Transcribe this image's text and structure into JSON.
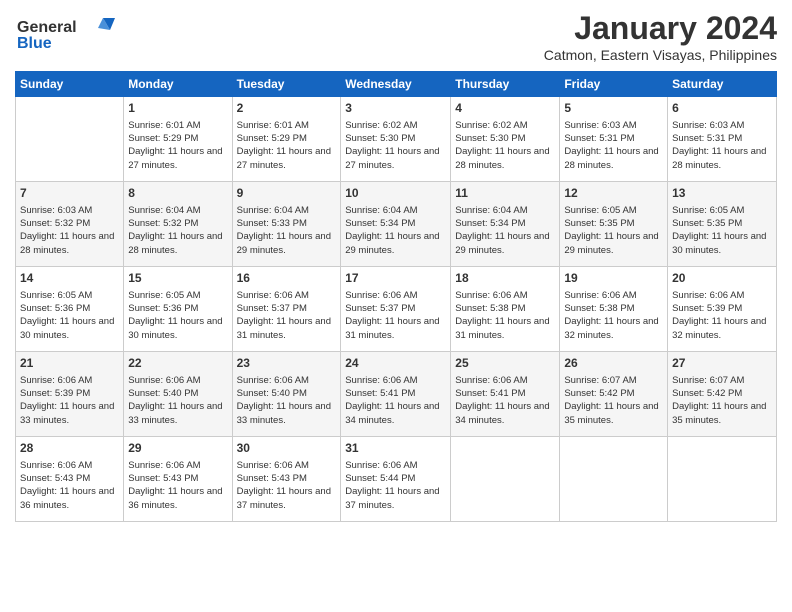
{
  "logo": {
    "line1": "General",
    "line2": "Blue"
  },
  "title": "January 2024",
  "subtitle": "Catmon, Eastern Visayas, Philippines",
  "days_of_week": [
    "Sunday",
    "Monday",
    "Tuesday",
    "Wednesday",
    "Thursday",
    "Friday",
    "Saturday"
  ],
  "weeks": [
    [
      {
        "day": "",
        "sunrise": "",
        "sunset": "",
        "daylight": ""
      },
      {
        "day": "1",
        "sunrise": "Sunrise: 6:01 AM",
        "sunset": "Sunset: 5:29 PM",
        "daylight": "Daylight: 11 hours and 27 minutes."
      },
      {
        "day": "2",
        "sunrise": "Sunrise: 6:01 AM",
        "sunset": "Sunset: 5:29 PM",
        "daylight": "Daylight: 11 hours and 27 minutes."
      },
      {
        "day": "3",
        "sunrise": "Sunrise: 6:02 AM",
        "sunset": "Sunset: 5:30 PM",
        "daylight": "Daylight: 11 hours and 27 minutes."
      },
      {
        "day": "4",
        "sunrise": "Sunrise: 6:02 AM",
        "sunset": "Sunset: 5:30 PM",
        "daylight": "Daylight: 11 hours and 28 minutes."
      },
      {
        "day": "5",
        "sunrise": "Sunrise: 6:03 AM",
        "sunset": "Sunset: 5:31 PM",
        "daylight": "Daylight: 11 hours and 28 minutes."
      },
      {
        "day": "6",
        "sunrise": "Sunrise: 6:03 AM",
        "sunset": "Sunset: 5:31 PM",
        "daylight": "Daylight: 11 hours and 28 minutes."
      }
    ],
    [
      {
        "day": "7",
        "sunrise": "Sunrise: 6:03 AM",
        "sunset": "Sunset: 5:32 PM",
        "daylight": "Daylight: 11 hours and 28 minutes."
      },
      {
        "day": "8",
        "sunrise": "Sunrise: 6:04 AM",
        "sunset": "Sunset: 5:32 PM",
        "daylight": "Daylight: 11 hours and 28 minutes."
      },
      {
        "day": "9",
        "sunrise": "Sunrise: 6:04 AM",
        "sunset": "Sunset: 5:33 PM",
        "daylight": "Daylight: 11 hours and 29 minutes."
      },
      {
        "day": "10",
        "sunrise": "Sunrise: 6:04 AM",
        "sunset": "Sunset: 5:34 PM",
        "daylight": "Daylight: 11 hours and 29 minutes."
      },
      {
        "day": "11",
        "sunrise": "Sunrise: 6:04 AM",
        "sunset": "Sunset: 5:34 PM",
        "daylight": "Daylight: 11 hours and 29 minutes."
      },
      {
        "day": "12",
        "sunrise": "Sunrise: 6:05 AM",
        "sunset": "Sunset: 5:35 PM",
        "daylight": "Daylight: 11 hours and 29 minutes."
      },
      {
        "day": "13",
        "sunrise": "Sunrise: 6:05 AM",
        "sunset": "Sunset: 5:35 PM",
        "daylight": "Daylight: 11 hours and 30 minutes."
      }
    ],
    [
      {
        "day": "14",
        "sunrise": "Sunrise: 6:05 AM",
        "sunset": "Sunset: 5:36 PM",
        "daylight": "Daylight: 11 hours and 30 minutes."
      },
      {
        "day": "15",
        "sunrise": "Sunrise: 6:05 AM",
        "sunset": "Sunset: 5:36 PM",
        "daylight": "Daylight: 11 hours and 30 minutes."
      },
      {
        "day": "16",
        "sunrise": "Sunrise: 6:06 AM",
        "sunset": "Sunset: 5:37 PM",
        "daylight": "Daylight: 11 hours and 31 minutes."
      },
      {
        "day": "17",
        "sunrise": "Sunrise: 6:06 AM",
        "sunset": "Sunset: 5:37 PM",
        "daylight": "Daylight: 11 hours and 31 minutes."
      },
      {
        "day": "18",
        "sunrise": "Sunrise: 6:06 AM",
        "sunset": "Sunset: 5:38 PM",
        "daylight": "Daylight: 11 hours and 31 minutes."
      },
      {
        "day": "19",
        "sunrise": "Sunrise: 6:06 AM",
        "sunset": "Sunset: 5:38 PM",
        "daylight": "Daylight: 11 hours and 32 minutes."
      },
      {
        "day": "20",
        "sunrise": "Sunrise: 6:06 AM",
        "sunset": "Sunset: 5:39 PM",
        "daylight": "Daylight: 11 hours and 32 minutes."
      }
    ],
    [
      {
        "day": "21",
        "sunrise": "Sunrise: 6:06 AM",
        "sunset": "Sunset: 5:39 PM",
        "daylight": "Daylight: 11 hours and 33 minutes."
      },
      {
        "day": "22",
        "sunrise": "Sunrise: 6:06 AM",
        "sunset": "Sunset: 5:40 PM",
        "daylight": "Daylight: 11 hours and 33 minutes."
      },
      {
        "day": "23",
        "sunrise": "Sunrise: 6:06 AM",
        "sunset": "Sunset: 5:40 PM",
        "daylight": "Daylight: 11 hours and 33 minutes."
      },
      {
        "day": "24",
        "sunrise": "Sunrise: 6:06 AM",
        "sunset": "Sunset: 5:41 PM",
        "daylight": "Daylight: 11 hours and 34 minutes."
      },
      {
        "day": "25",
        "sunrise": "Sunrise: 6:06 AM",
        "sunset": "Sunset: 5:41 PM",
        "daylight": "Daylight: 11 hours and 34 minutes."
      },
      {
        "day": "26",
        "sunrise": "Sunrise: 6:07 AM",
        "sunset": "Sunset: 5:42 PM",
        "daylight": "Daylight: 11 hours and 35 minutes."
      },
      {
        "day": "27",
        "sunrise": "Sunrise: 6:07 AM",
        "sunset": "Sunset: 5:42 PM",
        "daylight": "Daylight: 11 hours and 35 minutes."
      }
    ],
    [
      {
        "day": "28",
        "sunrise": "Sunrise: 6:06 AM",
        "sunset": "Sunset: 5:43 PM",
        "daylight": "Daylight: 11 hours and 36 minutes."
      },
      {
        "day": "29",
        "sunrise": "Sunrise: 6:06 AM",
        "sunset": "Sunset: 5:43 PM",
        "daylight": "Daylight: 11 hours and 36 minutes."
      },
      {
        "day": "30",
        "sunrise": "Sunrise: 6:06 AM",
        "sunset": "Sunset: 5:43 PM",
        "daylight": "Daylight: 11 hours and 37 minutes."
      },
      {
        "day": "31",
        "sunrise": "Sunrise: 6:06 AM",
        "sunset": "Sunset: 5:44 PM",
        "daylight": "Daylight: 11 hours and 37 minutes."
      },
      {
        "day": "",
        "sunrise": "",
        "sunset": "",
        "daylight": ""
      },
      {
        "day": "",
        "sunrise": "",
        "sunset": "",
        "daylight": ""
      },
      {
        "day": "",
        "sunrise": "",
        "sunset": "",
        "daylight": ""
      }
    ]
  ]
}
